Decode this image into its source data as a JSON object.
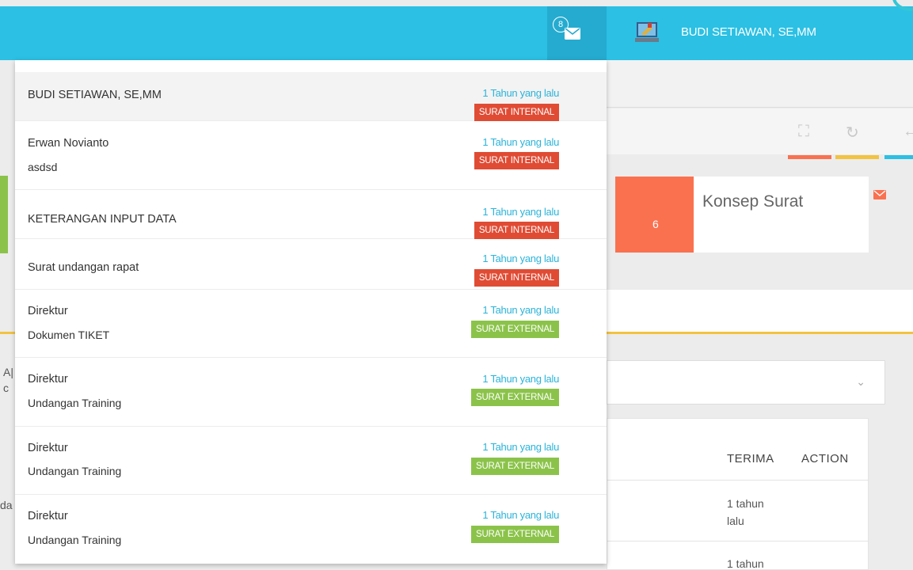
{
  "navbar": {
    "mail_count": "8",
    "user_name": "BUDI SETIAWAN, SE,MM"
  },
  "background": {
    "stat_card": {
      "value": "6",
      "label": "Konsep Surat"
    },
    "table_headers": [
      "TERIMA",
      "ACTION"
    ],
    "rows": [
      {
        "time": "1 tahun lalu"
      },
      {
        "time": "1 tahun"
      }
    ],
    "fragments": [
      "A|",
      "c",
      "da"
    ]
  },
  "notifications": [
    {
      "title": "BUDI SETIAWAN, SE,MM",
      "subtitle": "",
      "time": "1 Tahun yang lalu",
      "type": "SURAT INTERNAL"
    },
    {
      "title": "Erwan Novianto",
      "subtitle": "asdsd",
      "time": "1 Tahun yang lalu",
      "type": "SURAT INTERNAL"
    },
    {
      "title": "KETERANGAN INPUT DATA",
      "subtitle": "",
      "time": "1 Tahun yang lalu",
      "type": "SURAT INTERNAL"
    },
    {
      "title": "Surat undangan rapat",
      "subtitle": "",
      "time": "1 Tahun yang lalu",
      "type": "SURAT INTERNAL"
    },
    {
      "title": "Direktur",
      "subtitle": "Dokumen TIKET",
      "time": "1 Tahun yang lalu",
      "type": "SURAT EXTERNAL"
    },
    {
      "title": "Direktur",
      "subtitle": "Undangan Training",
      "time": "1 Tahun yang lalu",
      "type": "SURAT EXTERNAL"
    },
    {
      "title": "Direktur",
      "subtitle": "Undangan Training",
      "time": "1 Tahun yang lalu",
      "type": "SURAT EXTERNAL"
    },
    {
      "title": "Direktur",
      "subtitle": "Undangan Training",
      "time": "1 Tahun yang lalu",
      "type": "SURAT EXTERNAL"
    }
  ],
  "colors": {
    "navbar": "#2bc0e4",
    "internal_badge": "#e04b34",
    "external_badge": "#8bc34a",
    "time_text": "#2bb3d9",
    "stat_accent": "#fa7150"
  },
  "icons": {
    "mail": "envelope-icon",
    "user": "computer-user-icon",
    "fullscreen": "expand-icon",
    "refresh": "refresh-icon",
    "chevron": "chevron-down-icon"
  }
}
